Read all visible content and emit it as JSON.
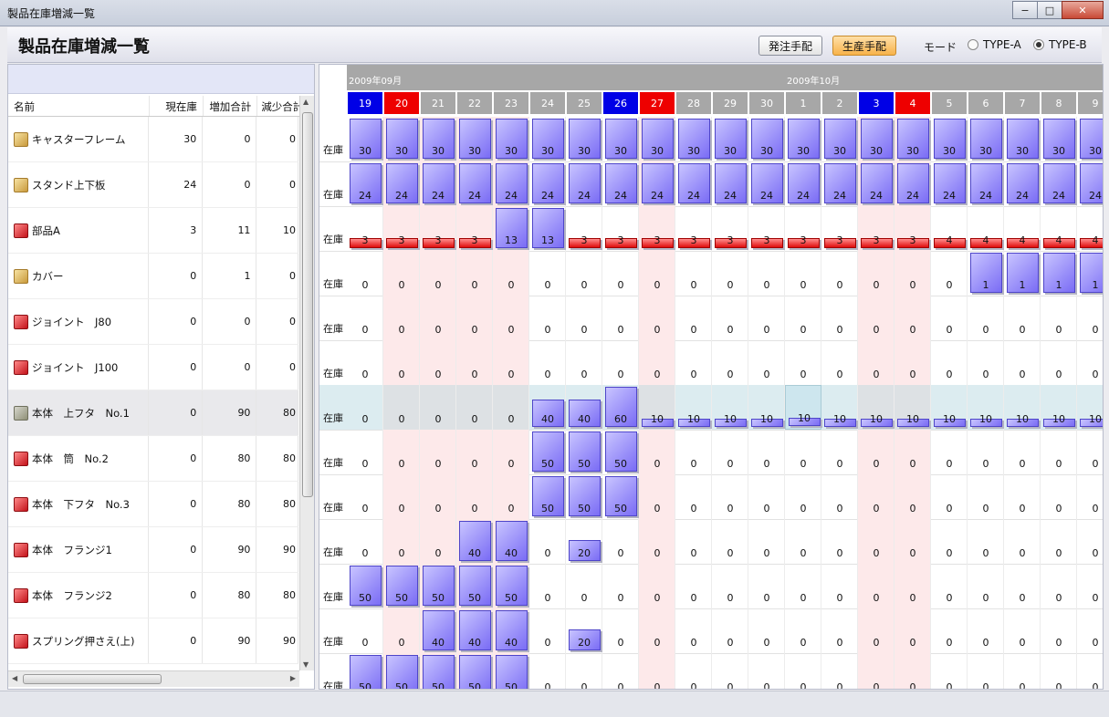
{
  "window": {
    "title": "製品在庫増減一覧",
    "min": "−",
    "max": "□",
    "close": "✕"
  },
  "header": {
    "title": "製品在庫増減一覧",
    "order_button": "発注手配",
    "production_button": "生産手配",
    "mode_label": "モード",
    "mode_a": "TYPE-A",
    "mode_b": "TYPE-B",
    "mode_selected": "TYPE-B"
  },
  "table": {
    "columns": [
      "名前",
      "現在庫",
      "増加合計",
      "減少合計"
    ],
    "rows": [
      {
        "name": "キャスターフレーム",
        "icon": "gold-box-icon",
        "stock": "30",
        "inc": "0",
        "dec": "0"
      },
      {
        "name": "スタンド上下板",
        "icon": "gold-box-icon",
        "stock": "24",
        "inc": "0",
        "dec": "0"
      },
      {
        "name": "部品A",
        "icon": "red-box-icon",
        "stock": "3",
        "inc": "11",
        "dec": "10"
      },
      {
        "name": "カバー",
        "icon": "gold-box-icon",
        "stock": "0",
        "inc": "1",
        "dec": "0"
      },
      {
        "name": "ジョイント　J80",
        "icon": "red-box-icon",
        "stock": "0",
        "inc": "0",
        "dec": "0"
      },
      {
        "name": "ジョイント　J100",
        "icon": "red-box-icon",
        "stock": "0",
        "inc": "0",
        "dec": "0"
      },
      {
        "name": "本体　上フタ　No.1",
        "icon": "gray-box-icon",
        "stock": "0",
        "inc": "90",
        "dec": "80"
      },
      {
        "name": "本体　筒　No.2",
        "icon": "red-box-icon",
        "stock": "0",
        "inc": "80",
        "dec": "80"
      },
      {
        "name": "本体　下フタ　No.3",
        "icon": "red-box-icon",
        "stock": "0",
        "inc": "80",
        "dec": "80"
      },
      {
        "name": "本体　フランジ1",
        "icon": "red-box-icon",
        "stock": "0",
        "inc": "90",
        "dec": "90"
      },
      {
        "name": "本体　フランジ2",
        "icon": "red-box-icon",
        "stock": "0",
        "inc": "80",
        "dec": "80"
      },
      {
        "name": "スプリング押さえ(上)",
        "icon": "red-box-icon",
        "stock": "0",
        "inc": "90",
        "dec": "90"
      }
    ],
    "selected_row": 6
  },
  "calendar": {
    "months": [
      {
        "label": "2009年09月",
        "start": 0
      },
      {
        "label": "2009年10月",
        "start": 12
      }
    ],
    "days": [
      "19",
      "20",
      "21",
      "22",
      "23",
      "24",
      "25",
      "26",
      "27",
      "28",
      "29",
      "30",
      "1",
      "2",
      "3",
      "4",
      "5",
      "6",
      "7",
      "8",
      "9"
    ],
    "day_types": [
      "sat",
      "sun",
      "",
      "",
      "",
      "",
      "",
      "sat",
      "sun",
      "",
      "",
      "",
      "",
      "",
      "sat",
      "sun",
      "",
      "",
      "",
      "",
      ""
    ],
    "holiday_cols": [
      1,
      2,
      3,
      4,
      8,
      14,
      15
    ],
    "row_label": "在庫",
    "highlight_cell": {
      "row": 6,
      "col": 12
    },
    "grid_rows": [
      {
        "values": [
          30,
          30,
          30,
          30,
          30,
          30,
          30,
          30,
          30,
          30,
          30,
          30,
          30,
          30,
          30,
          30,
          30,
          30,
          30,
          30,
          30
        ],
        "kind": "bars",
        "bar_max": 30
      },
      {
        "values": [
          24,
          24,
          24,
          24,
          24,
          24,
          24,
          24,
          24,
          24,
          24,
          24,
          24,
          24,
          24,
          24,
          24,
          24,
          24,
          24,
          24
        ],
        "kind": "bars",
        "bar_max": 24
      },
      {
        "values": [
          3,
          3,
          3,
          3,
          13,
          13,
          3,
          3,
          3,
          3,
          3,
          3,
          3,
          3,
          3,
          3,
          4,
          4,
          4,
          4,
          4
        ],
        "kind": "mixed",
        "bar_max": 13
      },
      {
        "values": [
          0,
          0,
          0,
          0,
          0,
          0,
          0,
          0,
          0,
          0,
          0,
          0,
          0,
          0,
          0,
          0,
          0,
          1,
          1,
          1,
          1
        ],
        "kind": "bars",
        "bar_max": 1
      },
      {
        "values": [
          0,
          0,
          0,
          0,
          0,
          0,
          0,
          0,
          0,
          0,
          0,
          0,
          0,
          0,
          0,
          0,
          0,
          0,
          0,
          0,
          0
        ],
        "kind": "bars",
        "bar_max": 1
      },
      {
        "values": [
          0,
          0,
          0,
          0,
          0,
          0,
          0,
          0,
          0,
          0,
          0,
          0,
          0,
          0,
          0,
          0,
          0,
          0,
          0,
          0,
          0
        ],
        "kind": "bars",
        "bar_max": 1
      },
      {
        "values": [
          0,
          0,
          0,
          0,
          0,
          40,
          40,
          60,
          10,
          10,
          10,
          10,
          10,
          10,
          10,
          10,
          10,
          10,
          10,
          10,
          10
        ],
        "kind": "bars",
        "bar_max": 60
      },
      {
        "values": [
          0,
          0,
          0,
          0,
          0,
          50,
          50,
          50,
          0,
          0,
          0,
          0,
          0,
          0,
          0,
          0,
          0,
          0,
          0,
          0,
          0
        ],
        "kind": "bars",
        "bar_max": 50
      },
      {
        "values": [
          0,
          0,
          0,
          0,
          0,
          50,
          50,
          50,
          0,
          0,
          0,
          0,
          0,
          0,
          0,
          0,
          0,
          0,
          0,
          0,
          0
        ],
        "kind": "bars",
        "bar_max": 50
      },
      {
        "values": [
          0,
          0,
          0,
          40,
          40,
          0,
          20,
          0,
          0,
          0,
          0,
          0,
          0,
          0,
          0,
          0,
          0,
          0,
          0,
          0,
          0
        ],
        "kind": "bars",
        "bar_max": 40
      },
      {
        "values": [
          50,
          50,
          50,
          50,
          50,
          0,
          0,
          0,
          0,
          0,
          0,
          0,
          0,
          0,
          0,
          0,
          0,
          0,
          0,
          0,
          0
        ],
        "kind": "bars",
        "bar_max": 50
      },
      {
        "values": [
          0,
          0,
          40,
          40,
          40,
          0,
          20,
          0,
          0,
          0,
          0,
          0,
          0,
          0,
          0,
          0,
          0,
          0,
          0,
          0,
          0
        ],
        "kind": "bars",
        "bar_max": 40
      },
      {
        "values": [
          50,
          50,
          50,
          50,
          50,
          0,
          0,
          0,
          0,
          0,
          0,
          0,
          0,
          0,
          0,
          0,
          0,
          0,
          0,
          0,
          0
        ],
        "kind": "bars",
        "bar_max": 50
      }
    ]
  },
  "colors": {
    "bar": "#8a7ef7",
    "low_bar": "#e00d0d",
    "saturday": "#0000e6",
    "sunday": "#ee0000",
    "holiday": "#fde9ea"
  }
}
